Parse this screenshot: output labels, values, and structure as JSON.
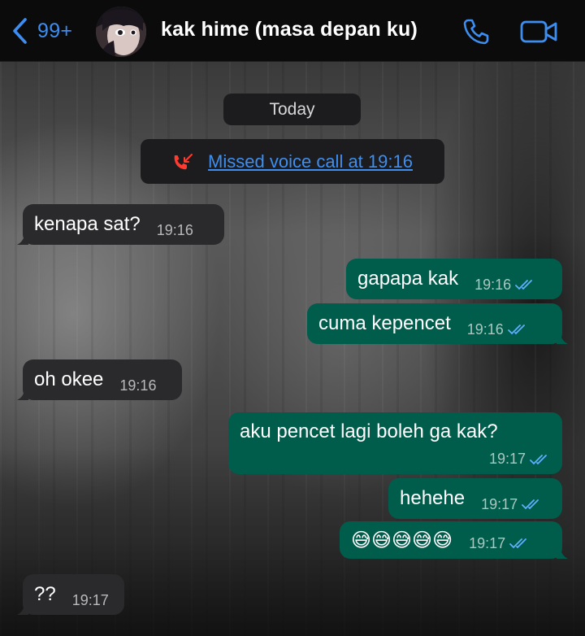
{
  "header": {
    "back_count": "99+",
    "contact_name": "kak hime (masa depan ku)",
    "icons": [
      "chevron-left-icon",
      "phone-icon",
      "video-camera-icon"
    ],
    "accent_color": "#3d8ef0"
  },
  "chat": {
    "date_separator": "Today",
    "missed_call": {
      "text": "Missed voice call at 19:16",
      "icon": "missed-call-icon",
      "color": "#ff3b30"
    },
    "messages": [
      {
        "direction": "in",
        "text": "kenapa sat?",
        "time": "19:16"
      },
      {
        "direction": "out",
        "text": "gapapa kak",
        "time": "19:16",
        "read": true
      },
      {
        "direction": "out",
        "text": "cuma kepencet",
        "time": "19:16",
        "read": true
      },
      {
        "direction": "in",
        "text": "oh okee",
        "time": "19:16"
      },
      {
        "direction": "out",
        "text": "aku pencet lagi boleh ga kak?",
        "time": "19:17",
        "read": true
      },
      {
        "direction": "out",
        "text": "hehehe",
        "time": "19:17",
        "read": true
      },
      {
        "direction": "out",
        "text": "😅😅😅😅😅",
        "time": "19:17",
        "read": true
      },
      {
        "direction": "in",
        "text": "??",
        "time": "19:17"
      }
    ],
    "colors": {
      "incoming": "#2a2a2c",
      "outgoing": "#005c4b",
      "read_ticks": "#5eb0ff"
    }
  }
}
